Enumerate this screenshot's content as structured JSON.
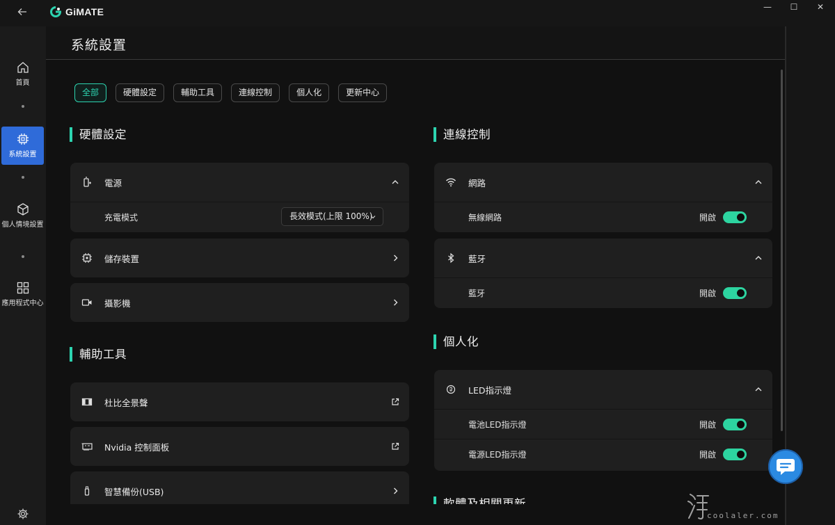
{
  "app": {
    "name": "GiMATE"
  },
  "window_controls": {
    "minimize": "—",
    "maximize": "☐",
    "close": "✕"
  },
  "sidebar": {
    "items": [
      {
        "label": "首頁",
        "icon": "home-icon"
      },
      {
        "label": "系統設置",
        "icon": "chip-icon",
        "active": true
      },
      {
        "label": "個人情境設置",
        "icon": "cube-icon"
      },
      {
        "label": "應用程式中心",
        "icon": "grid-icon"
      }
    ],
    "settings_icon": "gear-icon"
  },
  "header": {
    "title": "系統設置"
  },
  "tabs": [
    {
      "label": "全部",
      "active": true
    },
    {
      "label": "硬體設定"
    },
    {
      "label": "輔助工具"
    },
    {
      "label": "連線控制"
    },
    {
      "label": "個人化"
    },
    {
      "label": "更新中心"
    }
  ],
  "hardware": {
    "title": "硬體設定",
    "power": {
      "label": "電源",
      "icon": "battery-plug-icon",
      "charge_mode_label": "充電模式",
      "charge_mode_value": "長效模式(上限 100%)"
    },
    "storage": {
      "label": "儲存裝置",
      "icon": "chip-icon"
    },
    "camera": {
      "label": "攝影機",
      "icon": "camera-icon"
    }
  },
  "tools": {
    "title": "輔助工具",
    "dolby": {
      "label": "杜比全景聲",
      "icon": "dolby-icon"
    },
    "nvidia": {
      "label": "Nvidia 控制面板",
      "icon": "gpu-card-icon"
    },
    "backup": {
      "label": "智慧備份(USB)",
      "icon": "usb-icon"
    }
  },
  "connection": {
    "title": "連線控制",
    "network": {
      "label": "網路",
      "icon": "wifi-icon",
      "wireless_label": "無線網路",
      "wireless_state": "開啟",
      "wireless_on": true
    },
    "bluetooth": {
      "label": "藍牙",
      "icon": "bluetooth-icon",
      "bt_label": "藍牙",
      "bt_state": "開啟",
      "bt_on": true
    }
  },
  "personal": {
    "title": "個人化",
    "led": {
      "label": "LED指示燈",
      "icon": "led-icon",
      "battery_led_label": "電池LED指示燈",
      "battery_led_state": "開啟",
      "power_led_label": "電源LED指示燈",
      "power_led_state": "開啟"
    }
  },
  "update_partial_title": "軟體及相關更新",
  "watermark": {
    "text": "coolaler.com"
  },
  "colors": {
    "accent": "#2dd4b0",
    "sidebar_active": "#2f6bd9",
    "fab": "#2b8ae2"
  }
}
